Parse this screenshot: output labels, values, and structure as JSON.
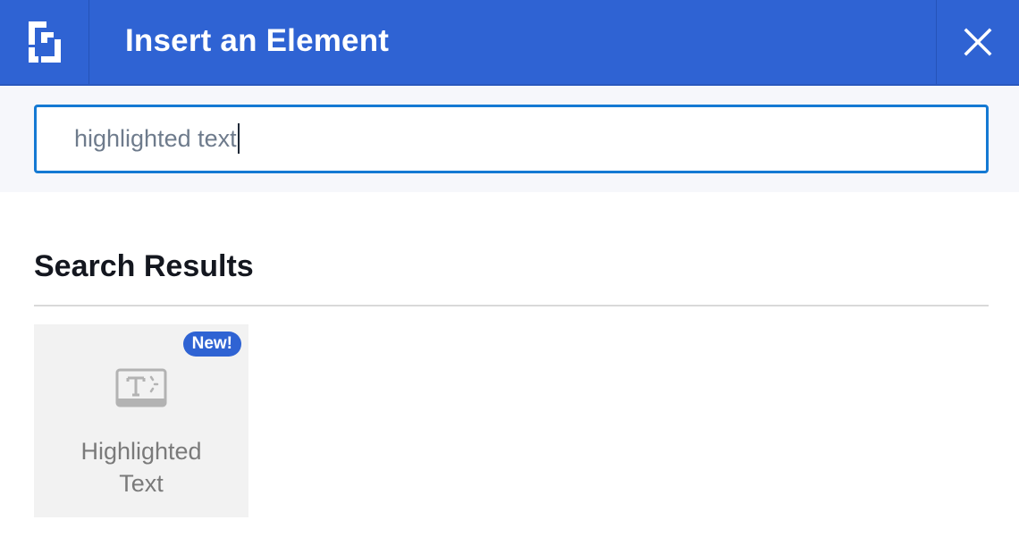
{
  "header": {
    "title": "Insert an Element",
    "logo_icon": "builder-logo-icon",
    "close_icon": "close-icon",
    "accent_color": "#2f63d3"
  },
  "search": {
    "value": "highlighted text",
    "border_color": "#1479d3"
  },
  "results": {
    "heading": "Search Results",
    "items": [
      {
        "label_line1": "Highlighted",
        "label_line2": "Text",
        "badge": "New!",
        "icon": "highlighted-text-icon"
      }
    ]
  }
}
